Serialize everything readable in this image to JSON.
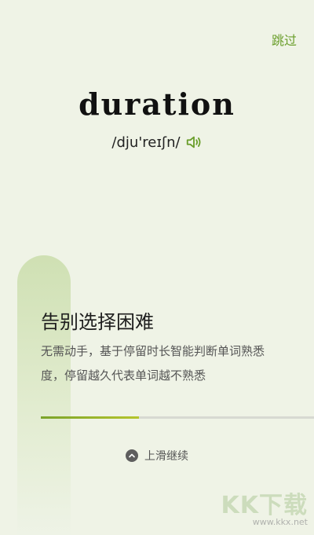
{
  "header": {
    "skip_label": "跳过"
  },
  "word": {
    "text": "duration",
    "phonetic": "/dju'reɪʃn/",
    "speaker_icon": "speaker-icon"
  },
  "card": {
    "title": "告别选择困难",
    "description": "无需动手，基于停留时长智能判断单词熟悉度，停留越久代表单词越不熟悉",
    "progress_fraction": 0.36
  },
  "footer": {
    "continue_label": "上滑继续",
    "continue_icon": "chevron-up-icon"
  },
  "watermark": {
    "logo": "KK下载",
    "url": "www.kkx.net"
  },
  "colors": {
    "accent": "#6a9e2b",
    "background": "#eff3e6"
  }
}
